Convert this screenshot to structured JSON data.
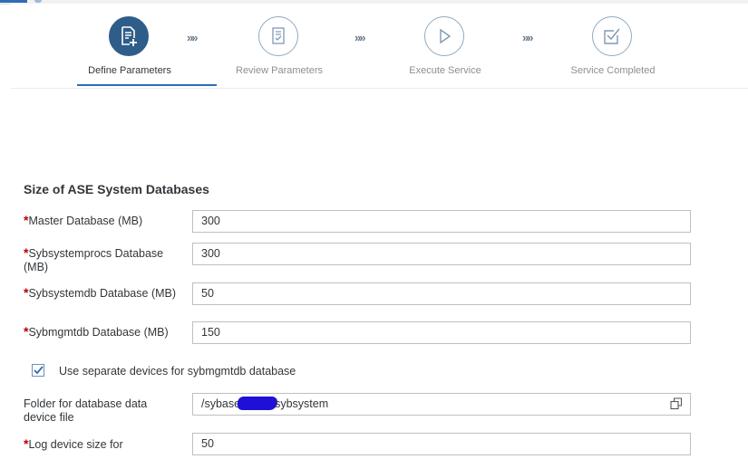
{
  "wizard": {
    "steps": [
      {
        "label": "Define Parameters",
        "state": "active",
        "icon": "document-add-icon"
      },
      {
        "label": "Review Parameters",
        "state": "inactive",
        "icon": "checklist-icon"
      },
      {
        "label": "Execute Service",
        "state": "inactive",
        "icon": "play-icon"
      },
      {
        "label": "Service Completed",
        "state": "inactive",
        "icon": "checkbox-complete-icon"
      }
    ],
    "separator": "»»"
  },
  "form": {
    "section_title": "Size of ASE System Databases",
    "fields": [
      {
        "label": "Master Database (MB)",
        "required": true,
        "value": "300"
      },
      {
        "label": "Sybsystemprocs Database (MB)",
        "required": true,
        "value": "300"
      },
      {
        "label": "Sybsystemdb Database (MB)",
        "required": true,
        "value": "50"
      },
      {
        "label": "Sybmgmtdb Database (MB)",
        "required": true,
        "value": "150"
      }
    ],
    "checkbox": {
      "label": "Use separate devices for sybmgmtdb database",
      "checked": true
    },
    "folder": {
      "label": "Folder for database data device file",
      "value_prefix": "/sybase",
      "value_suffix": "sybsystem"
    },
    "log": {
      "label": "Log device size for",
      "required": true,
      "value": "50"
    },
    "required_marker": "*"
  },
  "colors": {
    "accent": "#2f6db5",
    "active_step": "#2f5d8a",
    "required": "#bb0000",
    "redaction": "#1f10d8"
  }
}
